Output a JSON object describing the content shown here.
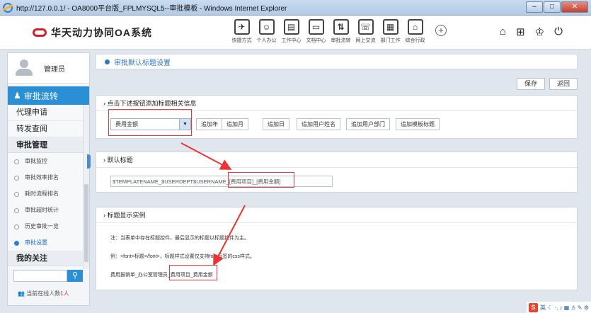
{
  "window": {
    "title": "http://127.0.0.1/ - OA8000平台版_FPLMYSQL5--审批模板 - Windows Internet Explorer",
    "min": "–",
    "max": "□",
    "close": "✕"
  },
  "app": {
    "title": "华天动力协同OA系统"
  },
  "modules": [
    {
      "icon": "send-icon",
      "glyph": "✈",
      "label": "快捷方式"
    },
    {
      "icon": "person-icon",
      "glyph": "☺",
      "label": "个人办公"
    },
    {
      "icon": "briefcase-icon",
      "glyph": "▤",
      "label": "工作中心"
    },
    {
      "icon": "document-icon",
      "glyph": "▭",
      "label": "文档中心"
    },
    {
      "icon": "flow-icon",
      "glyph": "⇅",
      "label": "审批流转"
    },
    {
      "icon": "chat-icon",
      "glyph": "☏",
      "label": "网上交流"
    },
    {
      "icon": "calendar-icon",
      "glyph": "▦",
      "label": "部门工作"
    },
    {
      "icon": "building-icon",
      "glyph": "⌂",
      "label": "综合行政"
    }
  ],
  "top_icons": [
    {
      "name": "home-icon",
      "glyph": "⌂"
    },
    {
      "name": "grid-icon",
      "glyph": "⊞"
    },
    {
      "name": "shirt-icon",
      "glyph": "♔"
    },
    {
      "name": "power-icon",
      "glyph": "⏻"
    }
  ],
  "sidebar": {
    "user": "管理员",
    "section": "审批流转",
    "items_top": [
      "代理申请",
      "转发查阅"
    ],
    "group": "审批管理",
    "sub_items": [
      {
        "label": "审批监控",
        "active": false
      },
      {
        "label": "审批效率排名",
        "active": false
      },
      {
        "label": "耗时流程排名",
        "active": false
      },
      {
        "label": "审批超时统计",
        "active": false
      },
      {
        "label": "历史审批一览",
        "active": false
      },
      {
        "label": "审批设置",
        "active": true
      }
    ],
    "bottom_item": "我的关注",
    "online_prefix": "当前在线人数",
    "online_count": "1",
    "online_suffix": "人"
  },
  "breadcrumb": "审批默认标题设置",
  "buttons": {
    "save": "保存",
    "back": "返回"
  },
  "card1": {
    "title": "› 点击下述按钮添加标题相关信息",
    "select_value": "费用金额",
    "add_buttons": [
      "追加年",
      "追加月",
      "追加日",
      "追加用户姓名",
      "追加用户部门",
      "追加模板标题"
    ]
  },
  "card2": {
    "title": "› 默认标题",
    "template_value": "$TEMPLATENAME_$USERDEPT$USERNAME_[费用项目]_[费用金额]"
  },
  "card3": {
    "title": "› 标题显示实例",
    "note1": "注：当表单中存在标题控件，最后显示的标题以标题控件为主。",
    "note2": "例：<font>标题</font>，标题样式设置仅支持font标签的css样式。",
    "example_prefix": "费用报销单_办公室管理员_",
    "example_highlight": "费用项目_费用金额"
  },
  "tray": {
    "ime": "英"
  }
}
